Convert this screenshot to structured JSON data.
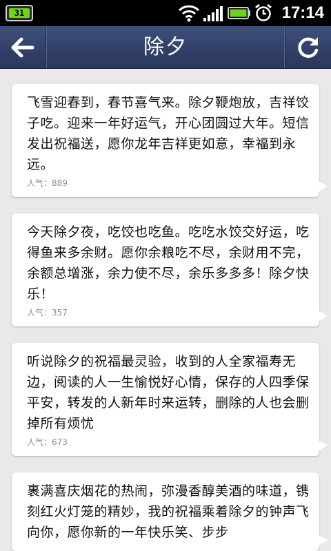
{
  "status_bar": {
    "app_badge": "31",
    "time": "17:14"
  },
  "header": {
    "title": "除夕",
    "back_icon": "back-arrow-icon",
    "refresh_icon": "refresh-icon"
  },
  "messages": [
    {
      "text": "飞雪迎春到，春节喜气来。除夕鞭炮放，吉祥饺子吃。迎来一年好运气，开心团圆过大年。短信发出祝福送，愿你龙年吉祥更如意，幸福到永远。",
      "popularity_label": "人气：",
      "popularity_value": "889"
    },
    {
      "text": "今天除夕夜，吃饺也吃鱼。吃吃水饺交好运，吃得鱼来多余财。愿你余粮吃不尽，余财用不完，余额总增涨，余力使不尽，余乐多多多！除夕快乐！",
      "popularity_label": "人气：",
      "popularity_value": "357"
    },
    {
      "text": "听说除夕的祝福最灵验，收到的人全家福寿无边，阅读的人一生愉悦好心情，保存的人四季保平安，转发的人新年时来运转，删除的人也会删掉所有烦忧",
      "popularity_label": "人气：",
      "popularity_value": "673"
    },
    {
      "text": "裹满喜庆烟花的热闹，弥漫香醇美酒的味道，镌刻红火灯笼的精妙，我的祝福乘着除夕的钟声飞向你，愿你新的一年快乐笑、步步",
      "popularity_label": "",
      "popularity_value": ""
    }
  ],
  "colors": {
    "navbar": "#34446e",
    "background": "#e9e9e9",
    "battery": "#6fd31c"
  }
}
